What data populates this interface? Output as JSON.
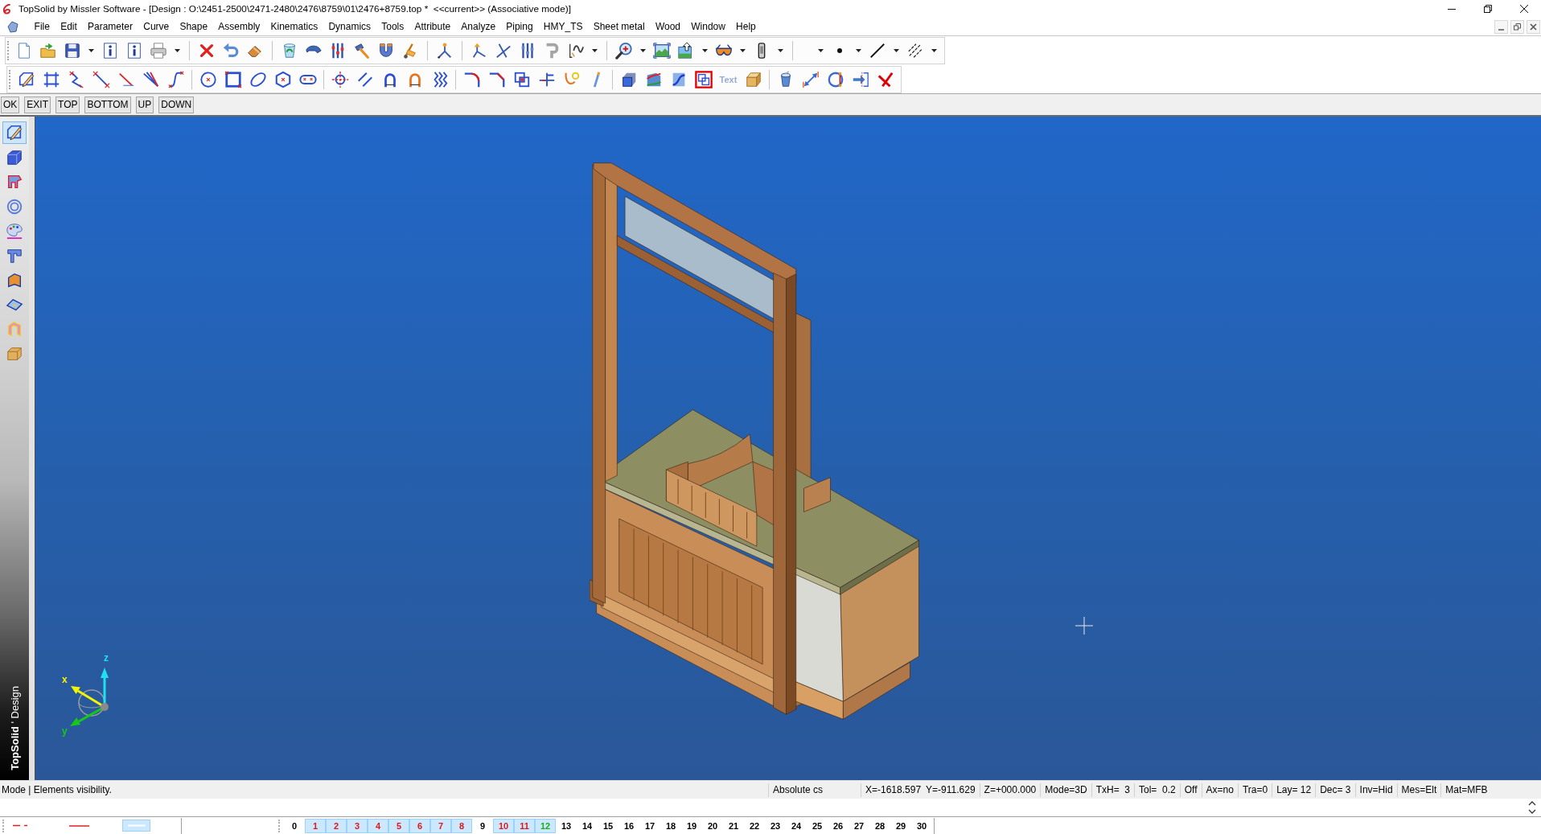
{
  "window": {
    "title": "TopSolid by Missler Software - [Design : O:\\2451-2500\\2471-2480\\2476\\8759\\01\\2476+8759.top *  <<current>> (Associative mode)]"
  },
  "menu_bar": [
    "File",
    "Edit",
    "Parameter",
    "Curve",
    "Shape",
    "Assembly",
    "Kinematics",
    "Dynamics",
    "Tools",
    "Attribute",
    "Analyze",
    "Piping",
    "HMY_TS",
    "Sheet metal",
    "Wood",
    "Window",
    "Help"
  ],
  "toolbars": {
    "text_tool": "Text"
  },
  "command_buttons": [
    "OK",
    "EXIT",
    "TOP",
    "BOTTOM",
    "UP",
    "DOWN"
  ],
  "mode_bar": {
    "items": [
      {
        "selected": true
      },
      {
        "selected": false
      },
      {
        "selected": false
      },
      {
        "selected": false
      },
      {
        "selected": false
      },
      {
        "selected": false
      },
      {
        "selected": false
      },
      {
        "selected": false
      },
      {
        "selected": false
      },
      {
        "selected": false
      }
    ],
    "brand": "**TopSolid** ' Design"
  },
  "viewport": {
    "axes": [
      {
        "label": "x",
        "color": "#f5f500"
      },
      {
        "label": "y",
        "color": "#18c818"
      },
      {
        "label": "z",
        "color": "#20e0f0"
      }
    ]
  },
  "status_bar": {
    "message": "Mode | Elements visibility.",
    "cells": [
      [
        "Absolute cs"
      ],
      [
        "X=-1618.597",
        "Y=-911.629"
      ],
      [
        "Z=+000.000"
      ],
      [
        "Mode=3D"
      ],
      [
        "TxH=  3"
      ],
      [
        "Tol=  0.2"
      ],
      [
        "Off"
      ],
      [
        "Ax=no"
      ],
      [
        "Tra=0"
      ],
      [
        "Lay= 12"
      ],
      [
        "Dec= 3"
      ],
      [
        "Inv=Hid"
      ],
      [
        "Mes=Elt"
      ],
      [
        "Mat=MFB"
      ]
    ]
  },
  "layer_bar": {
    "layers": [
      {
        "label": "0",
        "used": false,
        "selected": false
      },
      {
        "label": "1",
        "used": true,
        "selected": false
      },
      {
        "label": "2",
        "used": true,
        "selected": false
      },
      {
        "label": "3",
        "used": true,
        "selected": false
      },
      {
        "label": "4",
        "used": true,
        "selected": false
      },
      {
        "label": "5",
        "used": true,
        "selected": false
      },
      {
        "label": "6",
        "used": true,
        "selected": false
      },
      {
        "label": "7",
        "used": true,
        "selected": false
      },
      {
        "label": "8",
        "used": true,
        "selected": false
      },
      {
        "label": "9",
        "used": false,
        "selected": false
      },
      {
        "label": "10",
        "used": true,
        "selected": false
      },
      {
        "label": "11",
        "used": true,
        "selected": false
      },
      {
        "label": "12",
        "used": true,
        "selected": true
      },
      {
        "label": "13",
        "used": false,
        "selected": false
      },
      {
        "label": "14",
        "used": false,
        "selected": false
      },
      {
        "label": "15",
        "used": false,
        "selected": false
      },
      {
        "label": "16",
        "used": false,
        "selected": false
      },
      {
        "label": "17",
        "used": false,
        "selected": false
      },
      {
        "label": "18",
        "used": false,
        "selected": false
      },
      {
        "label": "19",
        "used": false,
        "selected": false
      },
      {
        "label": "20",
        "used": false,
        "selected": false
      },
      {
        "label": "21",
        "used": false,
        "selected": false
      },
      {
        "label": "22",
        "used": false,
        "selected": false
      },
      {
        "label": "23",
        "used": false,
        "selected": false
      },
      {
        "label": "24",
        "used": false,
        "selected": false
      },
      {
        "label": "25",
        "used": false,
        "selected": false
      },
      {
        "label": "26",
        "used": false,
        "selected": false
      },
      {
        "label": "27",
        "used": false,
        "selected": false
      },
      {
        "label": "28",
        "used": false,
        "selected": false
      },
      {
        "label": "29",
        "used": false,
        "selected": false
      },
      {
        "label": "30",
        "used": false,
        "selected": false
      }
    ]
  }
}
